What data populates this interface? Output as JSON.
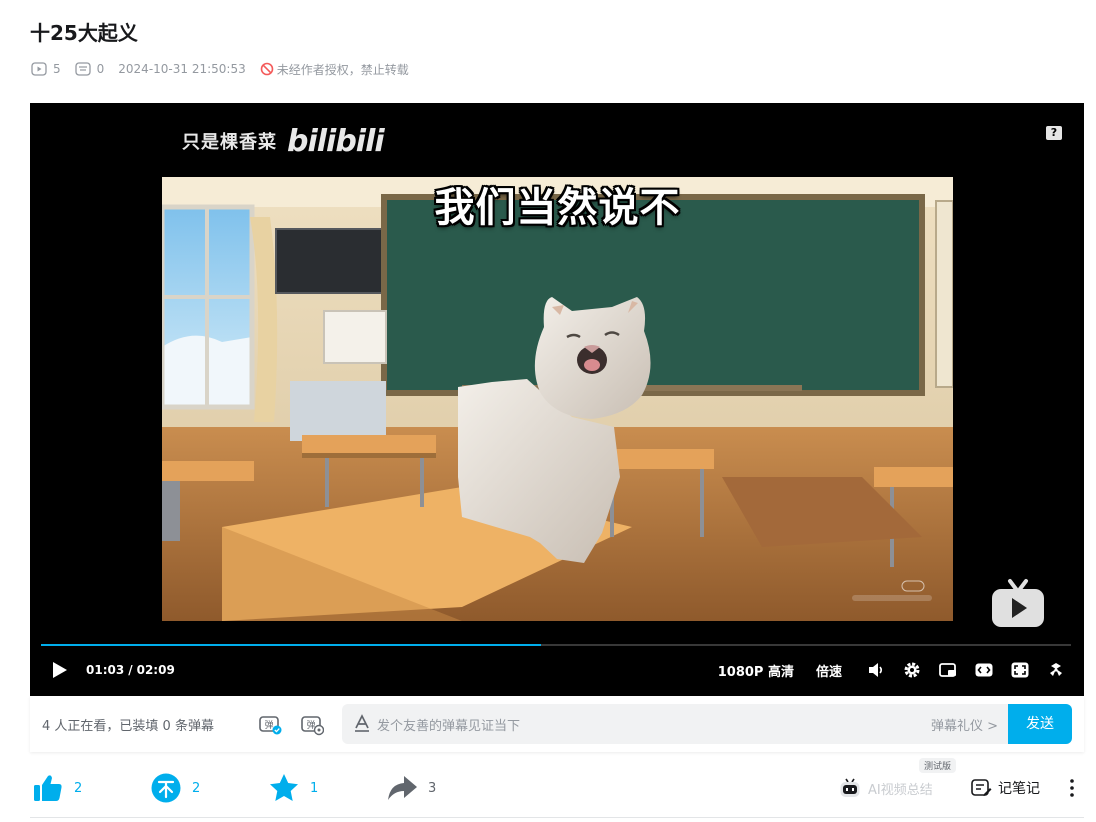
{
  "video": {
    "title": "十25大起义",
    "play_count": "5",
    "danmaku_count": "0",
    "pubdate": "2024-10-31 21:50:53",
    "copyright_notice": "未经作者授权，禁止转载"
  },
  "player": {
    "watermark_user": "只是棵香菜",
    "watermark_logo": "bilibili",
    "help_label": "?",
    "subtitle": "我们当然说不",
    "progress": 0.485,
    "current_time": "01:03",
    "time_separator": "/",
    "duration": "02:09",
    "quality": "1080P 高清",
    "speed": "倍速",
    "icons": [
      "play-icon",
      "volume-icon",
      "settings-icon",
      "pip-icon",
      "widescreen-icon",
      "web-fullscreen-icon",
      "fullscreen-icon",
      "bilibili-tv-icon"
    ]
  },
  "danmaku_bar": {
    "viewer_info": "4 人正在看，已装填 0 条弹幕",
    "input_placeholder": "发个友善的弹幕见证当下",
    "etiquette": "弹幕礼仪 >",
    "send": "发送"
  },
  "toolbar": {
    "like_count": "2",
    "coin_count": "2",
    "favorite_count": "1",
    "share_count": "3",
    "ai_summary": "AI视频总结",
    "beta_badge": "测试版",
    "notes": "记笔记"
  },
  "colors": {
    "accent": "#00aeec",
    "text_primary": "#18191c",
    "text_secondary": "#9499a0",
    "player_bg": "#000000"
  }
}
